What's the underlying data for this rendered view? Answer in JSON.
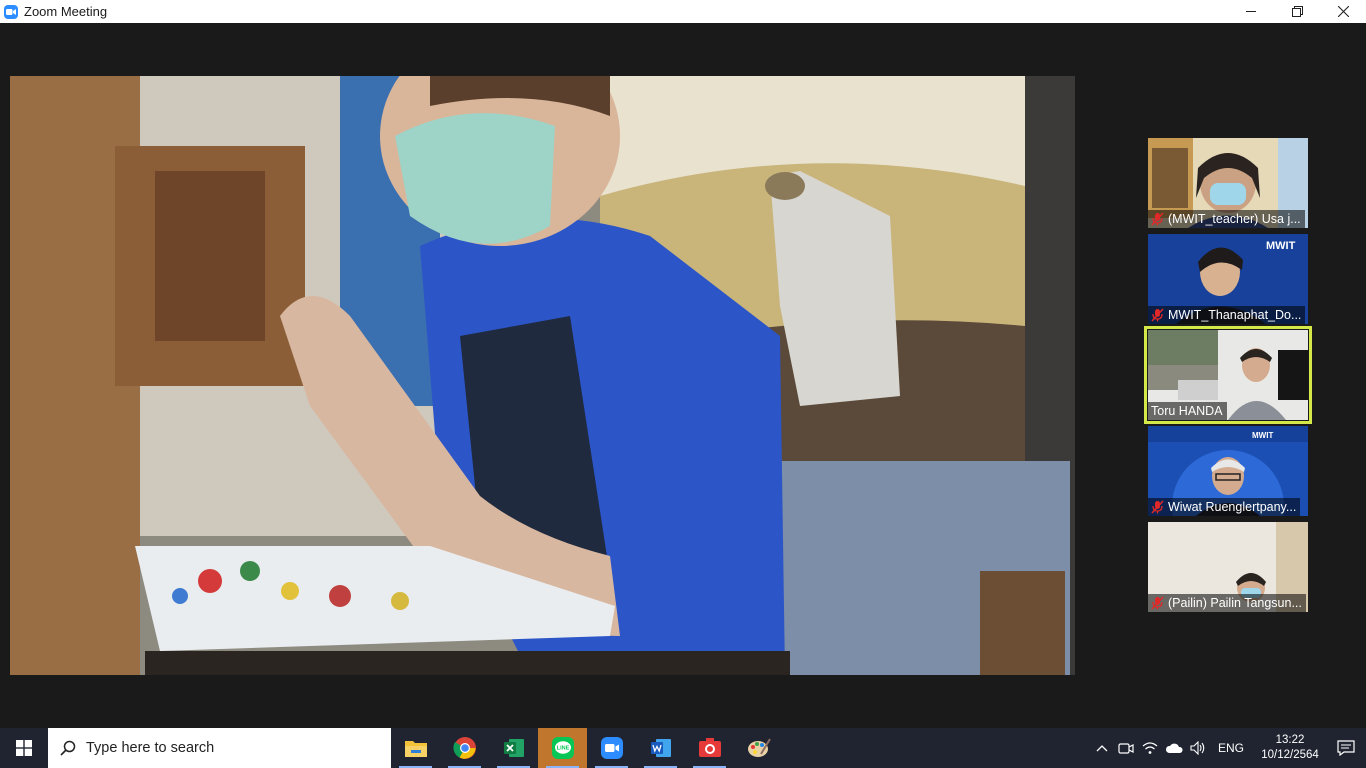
{
  "window": {
    "title": "Zoom Meeting",
    "minimize_icon": "minimize-icon",
    "restore_icon": "restore-icon",
    "close_icon": "close-icon"
  },
  "participants": [
    {
      "name": "(MWIT_teacher) Usa j...",
      "muted": true
    },
    {
      "name": "MWIT_Thanaphat_Do...",
      "muted": true
    },
    {
      "name": "Toru HANDA",
      "muted": false,
      "active_speaker": true
    },
    {
      "name": "Wiwat Ruenglertpany...",
      "muted": true
    },
    {
      "name": "(Pailin) Pailin Tangsun...",
      "muted": true
    }
  ],
  "tile_text": {
    "tile2_logo": "MWIT",
    "tile4_logo": "MWIT"
  },
  "taskbar": {
    "search_placeholder": "Type here to search",
    "apps": [
      "file-explorer-icon",
      "chrome-icon",
      "excel-icon",
      "line-icon",
      "zoom-icon",
      "word-icon",
      "camera-icon",
      "paint-icon"
    ],
    "language": "ENG",
    "time": "13:22",
    "date": "10/12/2564"
  },
  "colors": {
    "active_speaker_border": "#d5e84a",
    "zoom_blue": "#2d8cff",
    "mute_red": "#e02828"
  }
}
